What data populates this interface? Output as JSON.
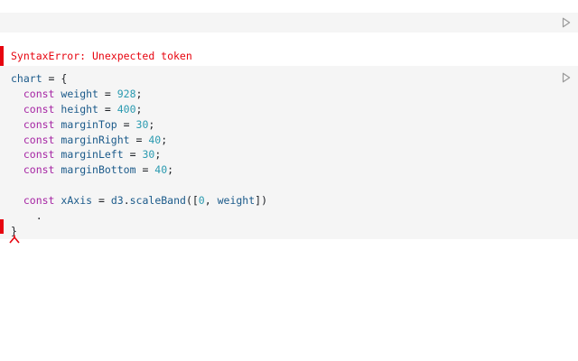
{
  "cells": {
    "empty": {
      "run_icon": "play-outline-icon"
    },
    "error": {
      "message": "SyntaxError: Unexpected token",
      "color": "#e7040f"
    },
    "code": {
      "run_icon": "play-outline-icon",
      "lines": [
        {
          "tokens": [
            {
              "t": "var",
              "v": "chart"
            },
            {
              "t": "punct",
              "v": " = {"
            }
          ]
        },
        {
          "tokens": [
            {
              "t": "punct",
              "v": "  "
            },
            {
              "t": "kw",
              "v": "const"
            },
            {
              "t": "punct",
              "v": " "
            },
            {
              "t": "var",
              "v": "weight"
            },
            {
              "t": "punct",
              "v": " = "
            },
            {
              "t": "num",
              "v": "928"
            },
            {
              "t": "punct",
              "v": ";"
            }
          ]
        },
        {
          "tokens": [
            {
              "t": "punct",
              "v": "  "
            },
            {
              "t": "kw",
              "v": "const"
            },
            {
              "t": "punct",
              "v": " "
            },
            {
              "t": "var",
              "v": "height"
            },
            {
              "t": "punct",
              "v": " = "
            },
            {
              "t": "num",
              "v": "400"
            },
            {
              "t": "punct",
              "v": ";"
            }
          ]
        },
        {
          "tokens": [
            {
              "t": "punct",
              "v": "  "
            },
            {
              "t": "kw",
              "v": "const"
            },
            {
              "t": "punct",
              "v": " "
            },
            {
              "t": "var",
              "v": "marginTop"
            },
            {
              "t": "punct",
              "v": " = "
            },
            {
              "t": "num",
              "v": "30"
            },
            {
              "t": "punct",
              "v": ";"
            }
          ]
        },
        {
          "tokens": [
            {
              "t": "punct",
              "v": "  "
            },
            {
              "t": "kw",
              "v": "const"
            },
            {
              "t": "punct",
              "v": " "
            },
            {
              "t": "var",
              "v": "marginRight"
            },
            {
              "t": "punct",
              "v": " = "
            },
            {
              "t": "num",
              "v": "40"
            },
            {
              "t": "punct",
              "v": ";"
            }
          ]
        },
        {
          "tokens": [
            {
              "t": "punct",
              "v": "  "
            },
            {
              "t": "kw",
              "v": "const"
            },
            {
              "t": "punct",
              "v": " "
            },
            {
              "t": "var",
              "v": "marginLeft"
            },
            {
              "t": "punct",
              "v": " = "
            },
            {
              "t": "num",
              "v": "30"
            },
            {
              "t": "punct",
              "v": ";"
            }
          ]
        },
        {
          "tokens": [
            {
              "t": "punct",
              "v": "  "
            },
            {
              "t": "kw",
              "v": "const"
            },
            {
              "t": "punct",
              "v": " "
            },
            {
              "t": "var",
              "v": "marginBottom"
            },
            {
              "t": "punct",
              "v": " = "
            },
            {
              "t": "num",
              "v": "40"
            },
            {
              "t": "punct",
              "v": ";"
            }
          ]
        },
        {
          "tokens": [
            {
              "t": "punct",
              "v": ""
            }
          ]
        },
        {
          "tokens": [
            {
              "t": "punct",
              "v": "  "
            },
            {
              "t": "kw",
              "v": "const"
            },
            {
              "t": "punct",
              "v": " "
            },
            {
              "t": "var",
              "v": "xAxis"
            },
            {
              "t": "punct",
              "v": " = "
            },
            {
              "t": "var",
              "v": "d3"
            },
            {
              "t": "punct",
              "v": "."
            },
            {
              "t": "fn",
              "v": "scaleBand"
            },
            {
              "t": "punct",
              "v": "(["
            },
            {
              "t": "num",
              "v": "0"
            },
            {
              "t": "punct",
              "v": ", "
            },
            {
              "t": "var",
              "v": "weight"
            },
            {
              "t": "punct",
              "v": "])"
            }
          ]
        },
        {
          "tokens": [
            {
              "t": "punct",
              "v": "    ."
            }
          ]
        },
        {
          "tokens": [
            {
              "t": "punct",
              "v": "}"
            }
          ]
        }
      ]
    }
  },
  "error_marker_icon": "error-caret-icon"
}
